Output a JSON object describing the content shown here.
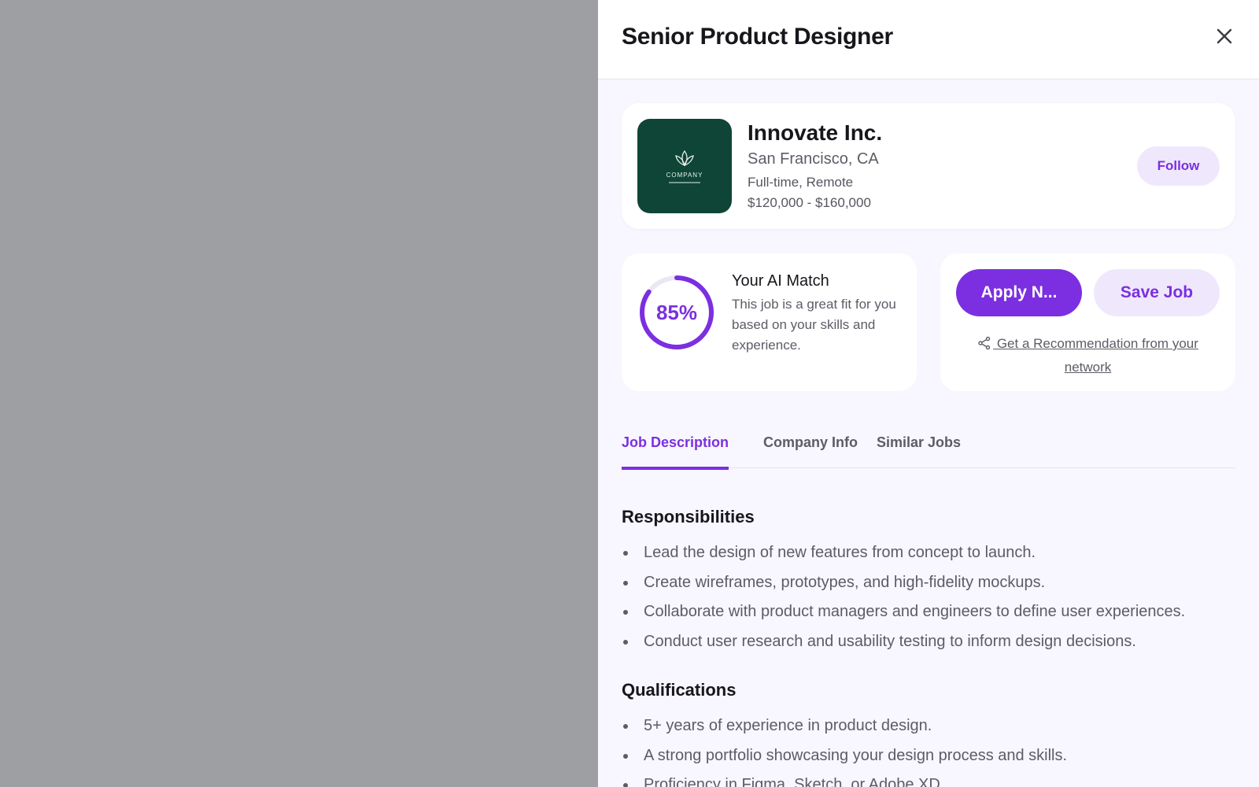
{
  "drawer": {
    "title": "Senior Product Designer"
  },
  "company": {
    "name": "Innovate Inc.",
    "location": "San Francisco, CA",
    "job_type": "Full-time, Remote",
    "salary": "$120,000 - $160,000",
    "follow_label": "Follow",
    "logo_text": "COMPANY"
  },
  "match": {
    "percent_label": "85%",
    "percent_value": 85,
    "title": "Your AI Match",
    "description": "This job is a great fit for you based on your skills and experience."
  },
  "actions": {
    "apply_label": "Apply N...",
    "save_label": "Save Job",
    "recommend_label": " Get a Recommendation from your network"
  },
  "tabs": [
    {
      "label": "Job Description",
      "active": true
    },
    {
      "label": "Company Info",
      "active": false
    },
    {
      "label": "Similar Jobs",
      "active": false
    }
  ],
  "responsibilities": {
    "heading": "Responsibilities",
    "items": [
      "Lead the design of new features from concept to launch.",
      "Create wireframes, prototypes, and high-fidelity mockups.",
      "Collaborate with product managers and engineers to define user experiences.",
      "Conduct user research and usability testing to inform design decisions."
    ]
  },
  "qualifications": {
    "heading": "Qualifications",
    "items": [
      "5+ years of experience in product design.",
      "A strong portfolio showcasing your design process and skills.",
      "Proficiency in Figma, Sketch, or Adobe XD."
    ]
  },
  "colors": {
    "accent": "#7b2fe0",
    "accent_light": "#efe8fd",
    "logo_bg": "#0e4536",
    "overlay": "#9e9fa3"
  }
}
